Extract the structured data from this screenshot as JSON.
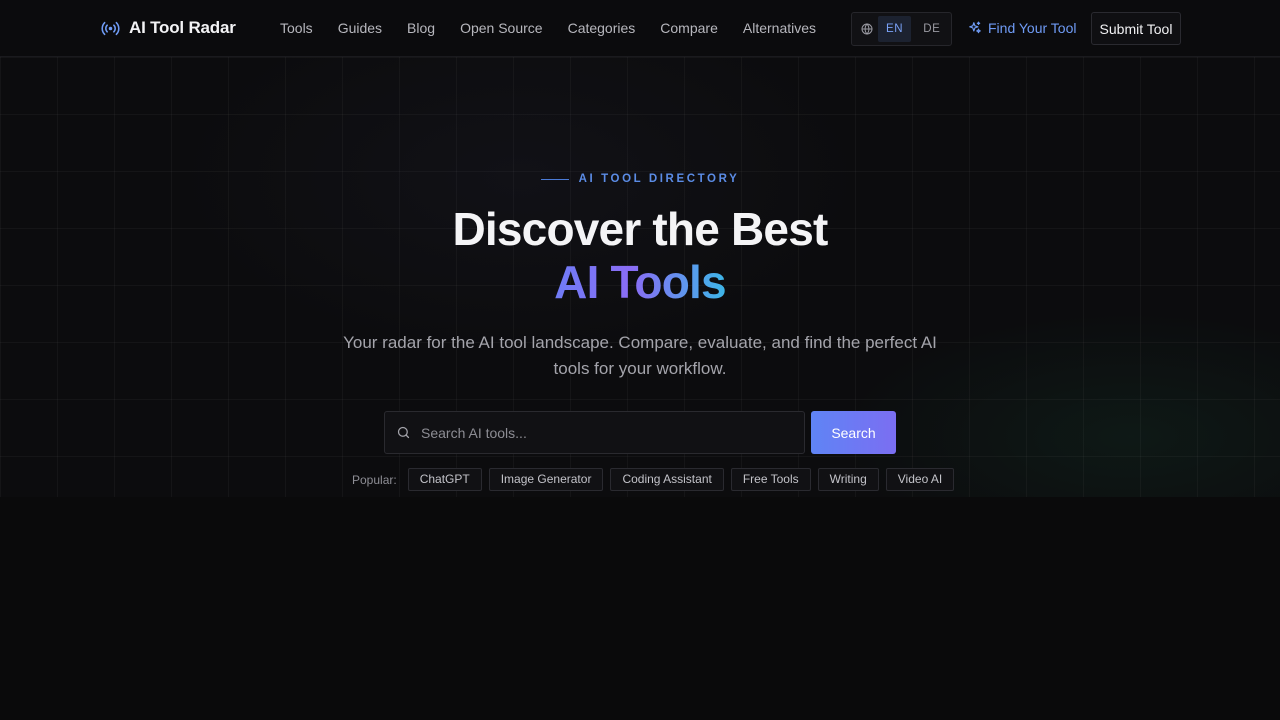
{
  "header": {
    "brand": "AI Tool Radar",
    "nav": [
      "Tools",
      "Guides",
      "Blog",
      "Open Source",
      "Categories",
      "Compare",
      "Alternatives"
    ],
    "language": {
      "options": [
        "EN",
        "DE"
      ],
      "selected": "EN"
    },
    "find_tool_label": "Find Your Tool",
    "submit_tool_label": "Submit Tool"
  },
  "hero": {
    "eyebrow": "AI TOOL DIRECTORY",
    "title_line1": "Discover the Best",
    "title_line2": "AI Tools",
    "subtitle": "Your radar for the AI tool landscape. Compare, evaluate, and find the perfect AI tools for your workflow.",
    "search": {
      "placeholder": "Search AI tools...",
      "value": "",
      "button_label": "Search"
    },
    "popular": {
      "label": "Popular:",
      "tags": [
        "ChatGPT",
        "Image Generator",
        "Coding Assistant",
        "Free Tools",
        "Writing",
        "Video AI"
      ]
    }
  },
  "colors": {
    "accent_blue": "#5b8ce6",
    "gradient_start": "#6f7cf6",
    "gradient_mid": "#8a6cf4",
    "gradient_end": "#3db6e8",
    "background": "#0a0a0b"
  },
  "icons": {
    "logo": "radar-broadcast-icon",
    "language": "globe-icon",
    "find_tool": "sparkles-icon",
    "search": "search-icon"
  }
}
